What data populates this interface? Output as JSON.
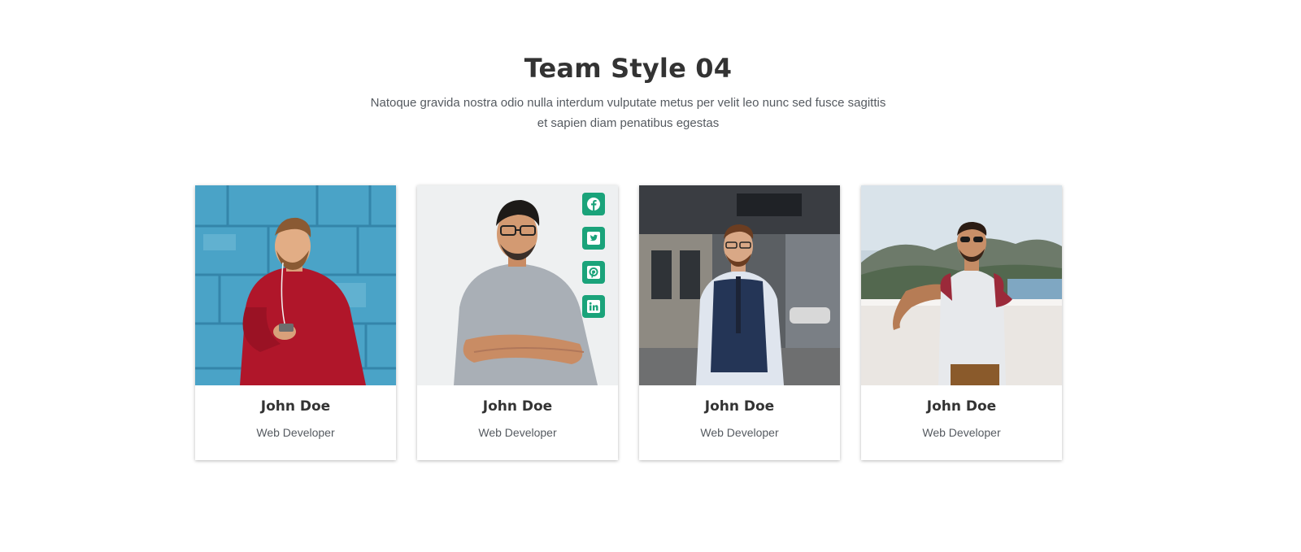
{
  "section": {
    "title": "Team Style 04",
    "subtitle": "Natoque gravida nostra odio nulla interdum vulputate metus per velit leo nunc sed fusce sagittis et sapien diam penatibus egestas"
  },
  "members": [
    {
      "name": "John Doe",
      "role": "Web Developer"
    },
    {
      "name": "John Doe",
      "role": "Web Developer"
    },
    {
      "name": "John Doe",
      "role": "Web Developer"
    },
    {
      "name": "John Doe",
      "role": "Web Developer"
    }
  ],
  "social_icons": [
    "facebook-icon",
    "twitter-icon",
    "pinterest-icon",
    "linkedin-icon"
  ],
  "colors": {
    "accent": "#1aa37a",
    "title": "#333333",
    "text": "#555a60"
  }
}
